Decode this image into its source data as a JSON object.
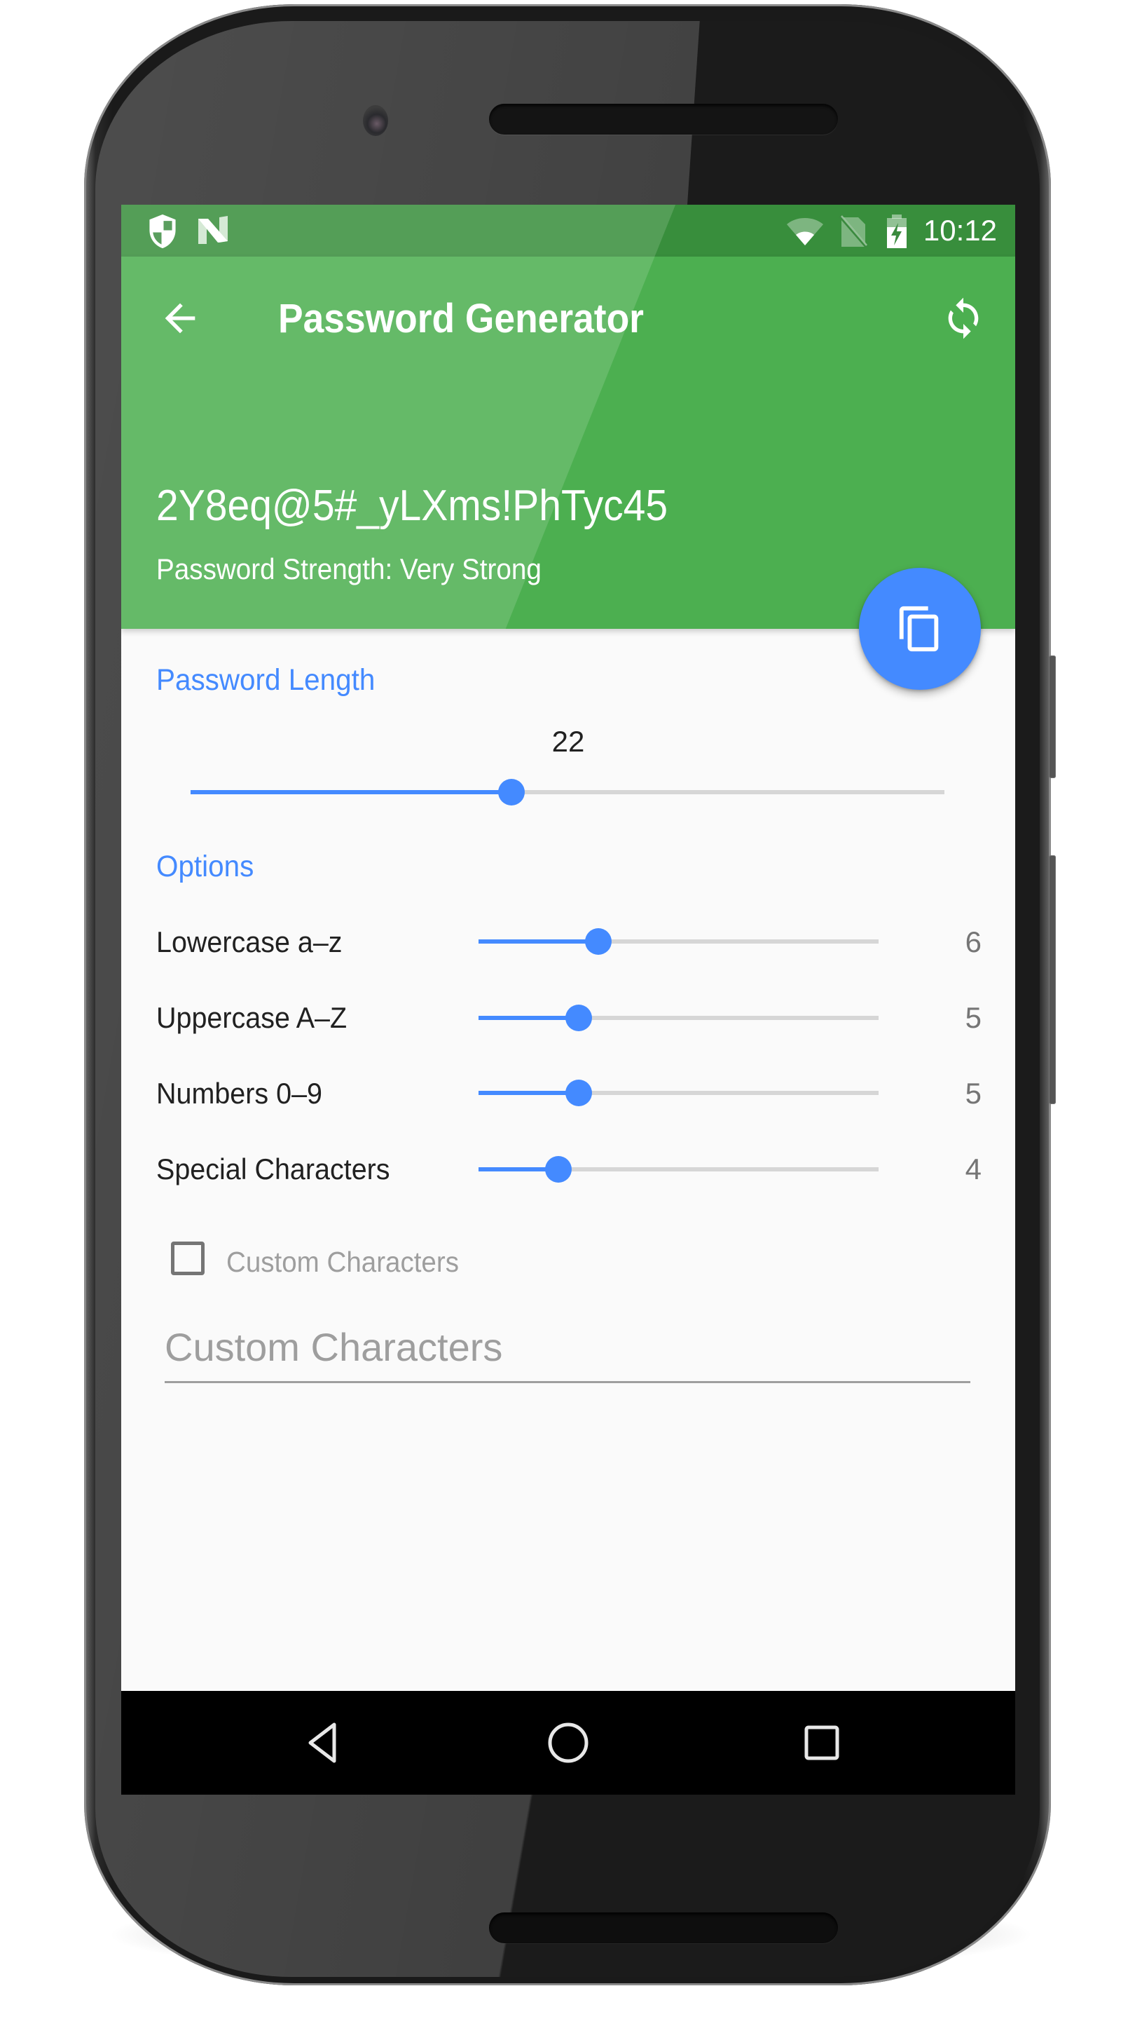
{
  "status_bar": {
    "time": "10:12",
    "left_icons": [
      "shield-icon",
      "n-logo-icon"
    ],
    "right_icons": [
      "wifi-icon",
      "no-sim-icon",
      "battery-charging-icon"
    ]
  },
  "app_bar": {
    "title": "Password Generator",
    "back_icon": "arrow-back-icon",
    "refresh_icon": "refresh-icon",
    "password": "2Y8eq@5#_yLXms!PhTyc45",
    "strength": "Password Strength: Very Strong",
    "fab_icon": "copy-icon"
  },
  "colors": {
    "primary": "#4caf50",
    "primary_dark": "#388e3c",
    "accent": "#448aff"
  },
  "length_section": {
    "title": "Password Length",
    "value": "22",
    "fraction": 0.426
  },
  "options_section": {
    "title": "Options",
    "items": [
      {
        "label": "Lowercase a–z",
        "value": "6",
        "fraction": 0.3
      },
      {
        "label": "Uppercase A–Z",
        "value": "5",
        "fraction": 0.25
      },
      {
        "label": "Numbers 0–9",
        "value": "5",
        "fraction": 0.25
      },
      {
        "label": "Special Characters",
        "value": "4",
        "fraction": 0.2
      }
    ]
  },
  "custom": {
    "checkbox_label": "Custom Characters",
    "checked": false,
    "input_placeholder": "Custom Characters",
    "input_value": ""
  },
  "nav_bar": {
    "back_icon": "nav-back-icon",
    "home_icon": "nav-home-icon",
    "recents_icon": "nav-recents-icon"
  }
}
